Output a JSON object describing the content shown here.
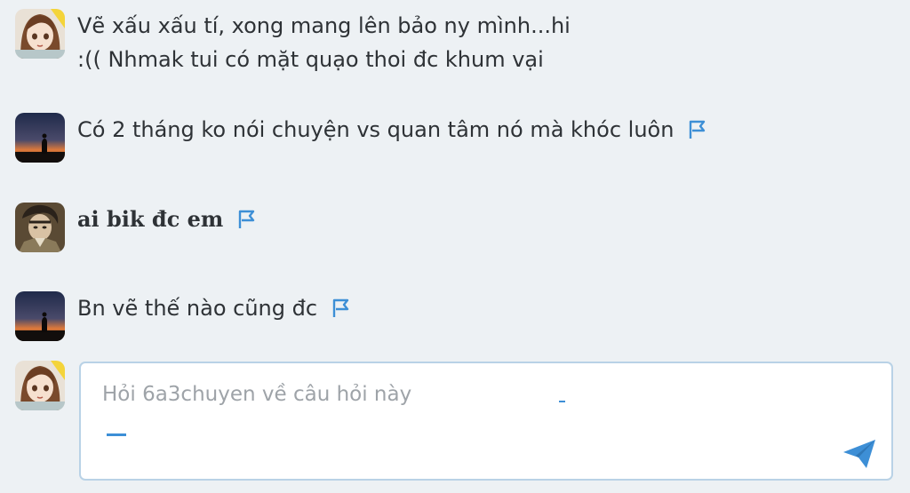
{
  "comments": [
    {
      "avatar": "anime-girl-avatar",
      "lines": [
        "Vẽ xấu xấu tí, xong mang lên bảo ny mình...hi",
        ":(( Nhmak tui có mặt quạo thoi đc khum vại"
      ]
    },
    {
      "avatar": "sunset-silhouette-avatar",
      "text": "Có 2 tháng ko nói chuyện vs quan tâm nó mà khóc luôn"
    },
    {
      "avatar": "anime-soldier-avatar",
      "text": "ai bik đc em"
    },
    {
      "avatar": "sunset-silhouette-avatar",
      "text": "Bn vẽ thế nào cũng đc"
    }
  ],
  "reply": {
    "avatar": "anime-girl-avatar",
    "placeholder": "Hỏi 6a3chuyen về câu hỏi này",
    "value": "",
    "send_icon": "send-icon"
  },
  "colors": {
    "background": "#edf1f4",
    "flag": "#3d8fd6",
    "input_border": "#b9d2e6",
    "send": "#3d8fd6"
  }
}
